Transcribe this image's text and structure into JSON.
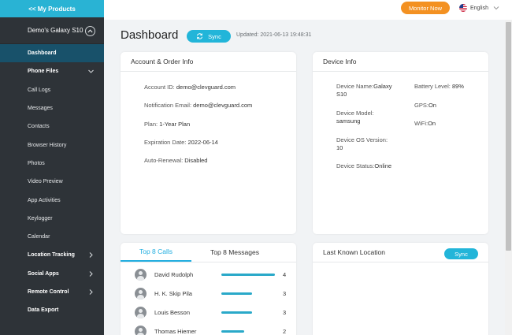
{
  "sidebar": {
    "top_link": "<< My Products",
    "device_name": "Demo's Galaxy S10",
    "items": [
      {
        "label": "Dashboard"
      },
      {
        "label": "Phone Files"
      },
      {
        "label": "Call Logs"
      },
      {
        "label": "Messages"
      },
      {
        "label": "Contacts"
      },
      {
        "label": "Browser History"
      },
      {
        "label": "Photos"
      },
      {
        "label": "Video Preview"
      },
      {
        "label": "App Activities"
      },
      {
        "label": "Keylogger"
      },
      {
        "label": "Calendar"
      },
      {
        "label": "Location Tracking"
      },
      {
        "label": "Social Apps"
      },
      {
        "label": "Remote Control"
      },
      {
        "label": "Data Export"
      }
    ]
  },
  "topbar": {
    "monitor_now": "Monitor Now",
    "language": "English"
  },
  "header": {
    "title": "Dashboard",
    "sync_label": "Sync",
    "updated": "Updated: 2021-06-13 19:48:31"
  },
  "account_card": {
    "title": "Account & Order Info",
    "account_id_label": "Account ID:",
    "account_id": "demo@clevguard.com",
    "notification_email_label": "Notification Email:",
    "notification_email": "demo@clevguard.com",
    "plan_label": "Plan:",
    "plan": "1-Year Plan",
    "expiration_label": "Expiration Date:",
    "expiration": "2022-06-14",
    "auto_renewal_label": "Auto-Renewal:",
    "auto_renewal": "Disabled"
  },
  "device_card": {
    "title": "Device Info",
    "device_name_label": "Device Name:",
    "device_name": "Galaxy S10",
    "device_model_label": "Device Model:",
    "device_model": "samsung",
    "os_version_label": "Device OS Version:",
    "os_version": "10",
    "status_label": "Device Status:",
    "status": "Online",
    "battery_label": "Battery Level:",
    "battery": "89%",
    "gps_label": "GPS:",
    "gps": "On",
    "wifi_label": "WiFi:",
    "wifi": "On"
  },
  "top_card": {
    "tab_calls": "Top 8 Calls",
    "tab_messages": "Top 8 Messages",
    "calls": [
      {
        "name": "David Rudolph",
        "count": "4",
        "fraction": 1.0
      },
      {
        "name": "H. K. Skip Pila",
        "count": "3",
        "fraction": 0.58
      },
      {
        "name": "Louis Besson",
        "count": "3",
        "fraction": 0.58
      },
      {
        "name": "Thomas Hiemer",
        "count": "2",
        "fraction": 0.42
      }
    ]
  },
  "location_card": {
    "title": "Last Known Location",
    "sync_label": "Sync"
  },
  "colors": {
    "accent": "#22b5d9",
    "sidebar_bg": "#2e3338",
    "sidebar_active": "#18516a",
    "monitor_button": "#f39122"
  }
}
